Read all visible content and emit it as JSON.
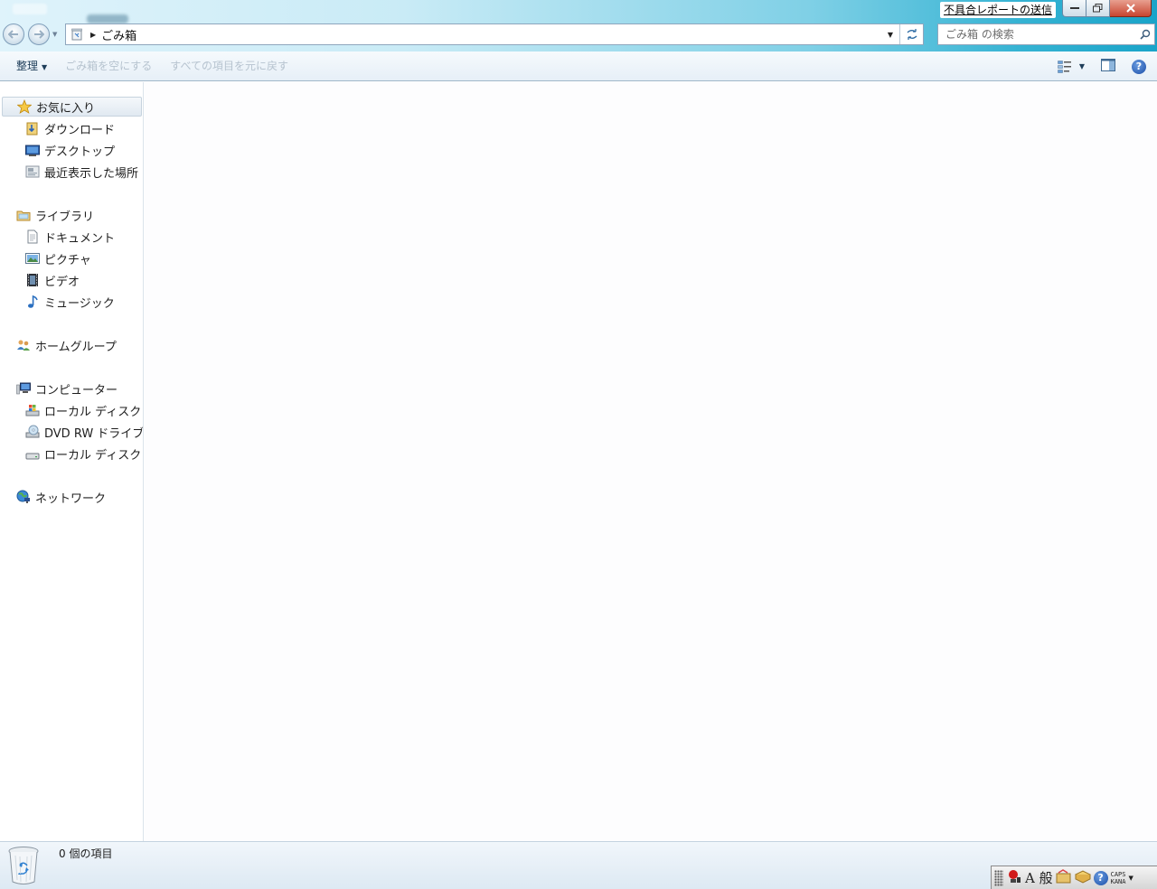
{
  "window": {
    "report_link": "不具合レポートの送信",
    "caption_buttons": [
      "minimize",
      "maximize",
      "close"
    ]
  },
  "address": {
    "path": "ごみ箱",
    "icon": "recycle-bin-icon"
  },
  "search": {
    "placeholder": "ごみ箱 の検索"
  },
  "commands": {
    "organize": "整理",
    "empty_bin": "ごみ箱を空にする",
    "restore_all": "すべての項目を元に戻す"
  },
  "sidebar": {
    "favorites": {
      "label": "お気に入り",
      "items": [
        {
          "label": "ダウンロード",
          "icon": "downloads-icon"
        },
        {
          "label": "デスクトップ",
          "icon": "desktop-icon"
        },
        {
          "label": "最近表示した場所",
          "icon": "recent-places-icon"
        }
      ]
    },
    "libraries": {
      "label": "ライブラリ",
      "items": [
        {
          "label": "ドキュメント",
          "icon": "documents-icon"
        },
        {
          "label": "ピクチャ",
          "icon": "pictures-icon"
        },
        {
          "label": "ビデオ",
          "icon": "videos-icon"
        },
        {
          "label": "ミュージック",
          "icon": "music-icon"
        }
      ]
    },
    "homegroup": {
      "label": "ホームグループ"
    },
    "computer": {
      "label": "コンピューター",
      "items": [
        {
          "label": "ローカル ディスク (",
          "icon": "system-drive-icon"
        },
        {
          "label": "DVD RW ドライブ",
          "icon": "dvd-drive-icon"
        },
        {
          "label": "ローカル ディスク (",
          "icon": "hard-drive-icon"
        }
      ]
    },
    "network": {
      "label": "ネットワーク"
    }
  },
  "details": {
    "item_count": "0 個の項目"
  },
  "ime": {
    "mode": "A 般",
    "caps": "CAPS",
    "kana": "KANA"
  }
}
